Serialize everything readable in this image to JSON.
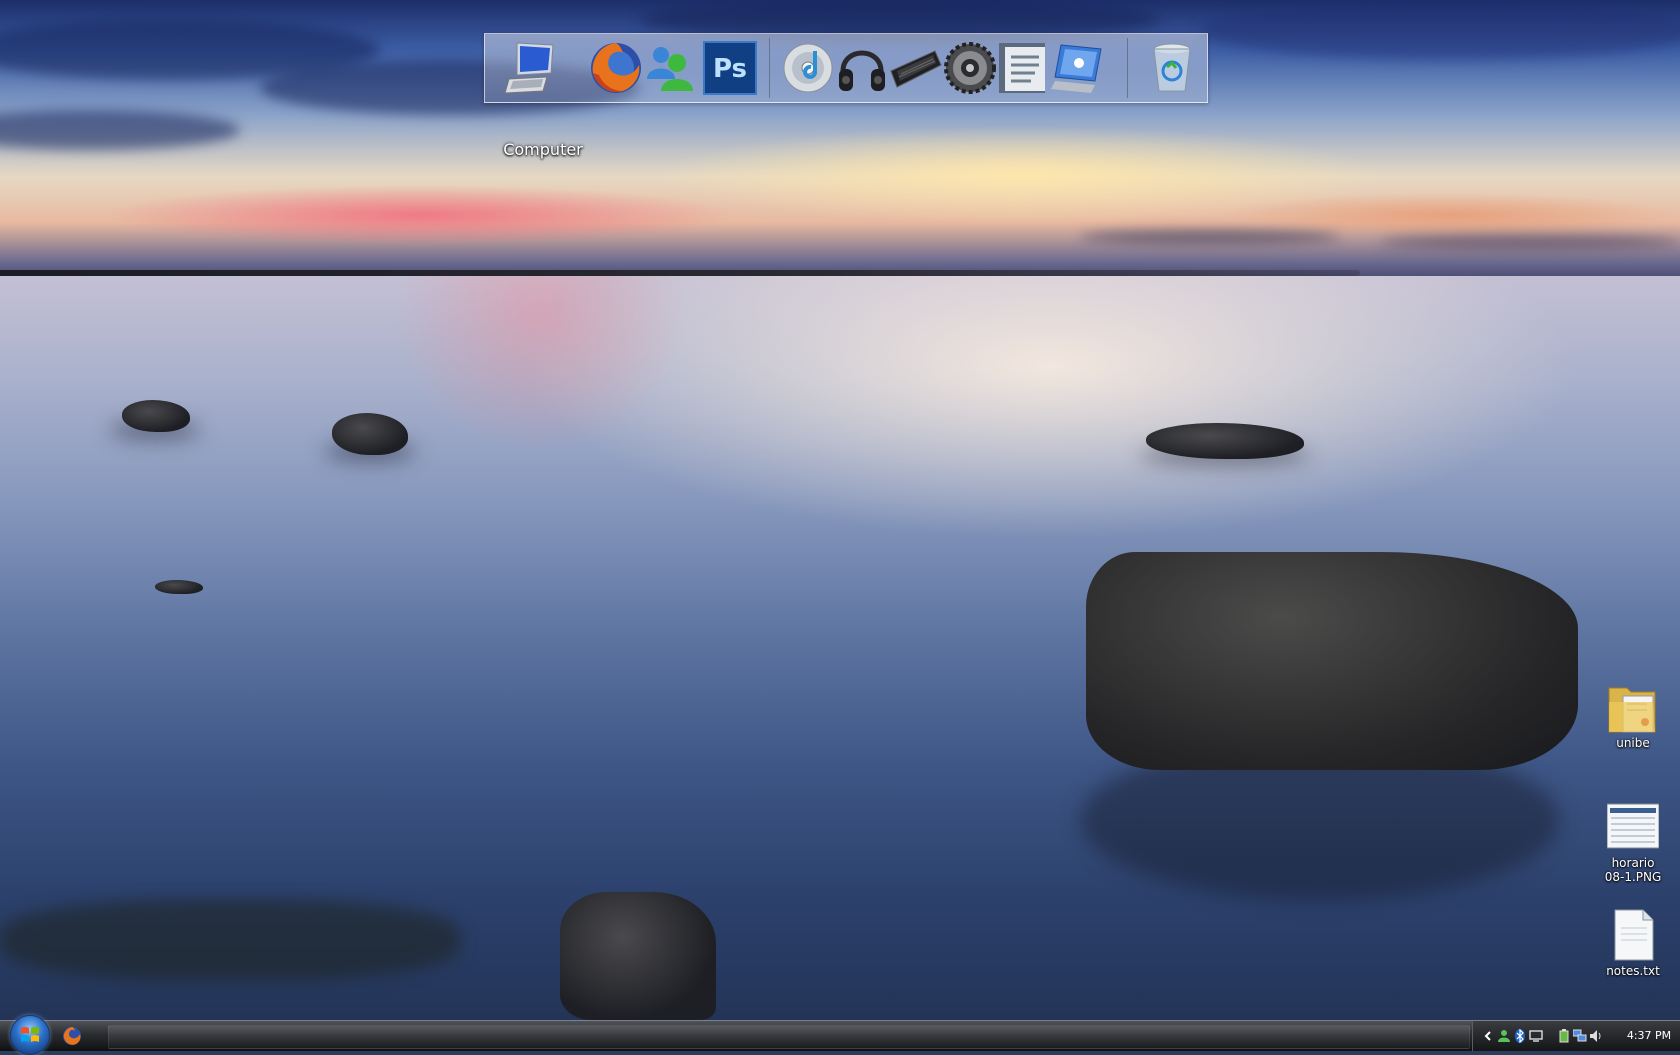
{
  "desktop": {
    "dock": {
      "items": [
        {
          "name": "Computer",
          "icon": "laptop-icon"
        },
        {
          "name": "Firefox",
          "icon": "firefox-icon"
        },
        {
          "name": "Messenger",
          "icon": "messenger-icon"
        },
        {
          "name": "Photoshop",
          "icon": "photoshop-icon",
          "text": "Ps"
        },
        {
          "name": "Media",
          "icon": "cd-icon"
        },
        {
          "name": "Audio",
          "icon": "headphones-icon"
        },
        {
          "name": "Keyboard",
          "icon": "keyboard-icon"
        },
        {
          "name": "Settings",
          "icon": "gear-icon"
        },
        {
          "name": "Documents",
          "icon": "document-icon"
        },
        {
          "name": "Control Panel",
          "icon": "control-panel-icon"
        },
        {
          "name": "Recycle Bin",
          "icon": "recycle-bin-icon"
        }
      ],
      "hover_label": "Computer"
    },
    "icons": [
      {
        "label": "unibe",
        "icon": "folder-icon"
      },
      {
        "label": "horario\n08-1.PNG",
        "icon": "image-file-icon"
      },
      {
        "label": "notes.txt",
        "icon": "text-file-icon"
      }
    ]
  },
  "taskbar": {
    "start_icon": "windows-logo-icon",
    "quick_launch": [
      "firefox-icon"
    ],
    "tray_icons": [
      "chevron-left-icon",
      "network-user-icon",
      "bluetooth-icon",
      "display-icon",
      "power-icon",
      "network-icon",
      "volume-icon"
    ],
    "clock": "4:37 PM"
  }
}
